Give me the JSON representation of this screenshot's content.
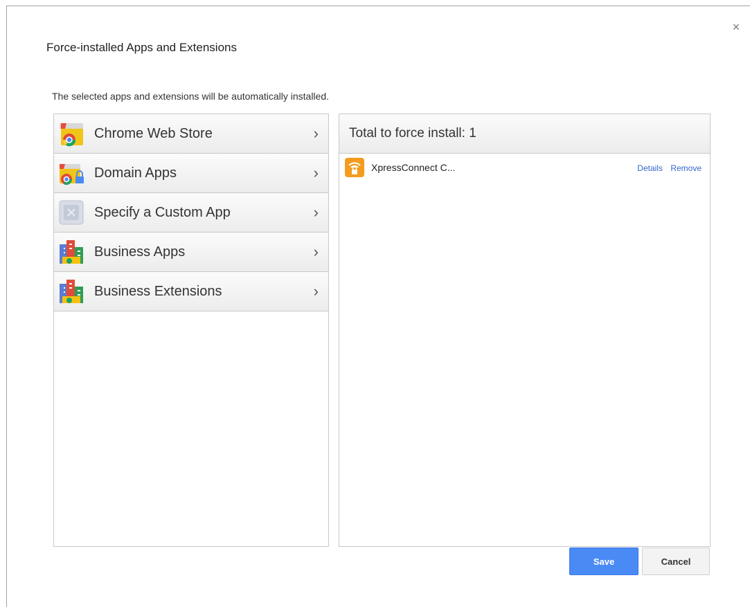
{
  "dialog": {
    "title": "Force-installed Apps and Extensions",
    "description": "The selected apps and extensions will be automatically installed.",
    "close_glyph": "×"
  },
  "categories": [
    {
      "label": "Chrome Web Store",
      "icon": "chrome-web-store-icon",
      "chevron": "›"
    },
    {
      "label": "Domain Apps",
      "icon": "domain-apps-icon",
      "chevron": "›"
    },
    {
      "label": "Specify a Custom App",
      "icon": "custom-app-icon",
      "chevron": "›"
    },
    {
      "label": "Business Apps",
      "icon": "business-apps-icon",
      "chevron": "›"
    },
    {
      "label": "Business Extensions",
      "icon": "business-extensions-icon",
      "chevron": "›"
    }
  ],
  "selected": {
    "header": "Total to force install: 1",
    "items": [
      {
        "name": "XpressConnect C...",
        "icon": "wifi-lock-icon",
        "details_label": "Details",
        "remove_label": "Remove"
      }
    ]
  },
  "buttons": {
    "save_label": "Save",
    "cancel_label": "Cancel"
  },
  "colors": {
    "accent": "#4a8af4",
    "link": "#3366cc",
    "app_icon": "#f39c1e"
  }
}
